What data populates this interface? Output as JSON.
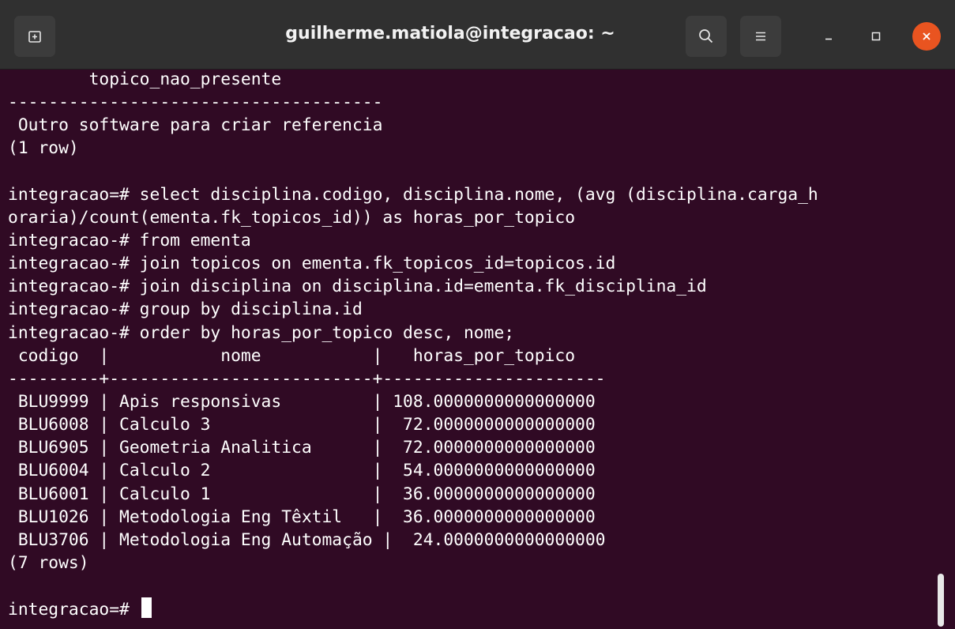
{
  "window": {
    "title": "guilherme.matiola@integracao: ~"
  },
  "icons": {
    "new_tab": "new-tab-icon",
    "search": "search-icon",
    "menu": "hamburger-menu-icon",
    "minimize": "minimize-icon",
    "maximize": "maximize-icon",
    "close": "close-icon"
  },
  "colors": {
    "terminal_bg": "#300a24",
    "titlebar_bg": "#303030",
    "close_button": "#e95420",
    "text": "#ffffff"
  },
  "terminal": {
    "lines": [
      "        topico_nao_presente",
      "-------------------------------------",
      " Outro software para criar referencia",
      "(1 row)",
      "",
      "integracao=# select disciplina.codigo, disciplina.nome, (avg (disciplina.carga_h",
      "oraria)/count(ementa.fk_topicos_id)) as horas_por_topico",
      "integracao-# from ementa",
      "integracao-# join topicos on ementa.fk_topicos_id=topicos.id",
      "integracao-# join disciplina on disciplina.id=ementa.fk_disciplina_id",
      "integracao-# group by disciplina.id",
      "integracao-# order by horas_por_topico desc, nome;",
      " codigo  |           nome           |   horas_por_topico",
      "---------+--------------------------+----------------------",
      " BLU9999 | Apis responsivas         | 108.0000000000000000",
      " BLU6008 | Calculo 3                |  72.0000000000000000",
      " BLU6905 | Geometria Analitica      |  72.0000000000000000",
      " BLU6004 | Calculo 2                |  54.0000000000000000",
      " BLU6001 | Calculo 1                |  36.0000000000000000",
      " BLU1026 | Metodologia Eng Têxtil   |  36.0000000000000000",
      " BLU3706 | Metodologia Eng Automação |  24.0000000000000000",
      "(7 rows)",
      ""
    ],
    "prompt": "integracao=# "
  }
}
